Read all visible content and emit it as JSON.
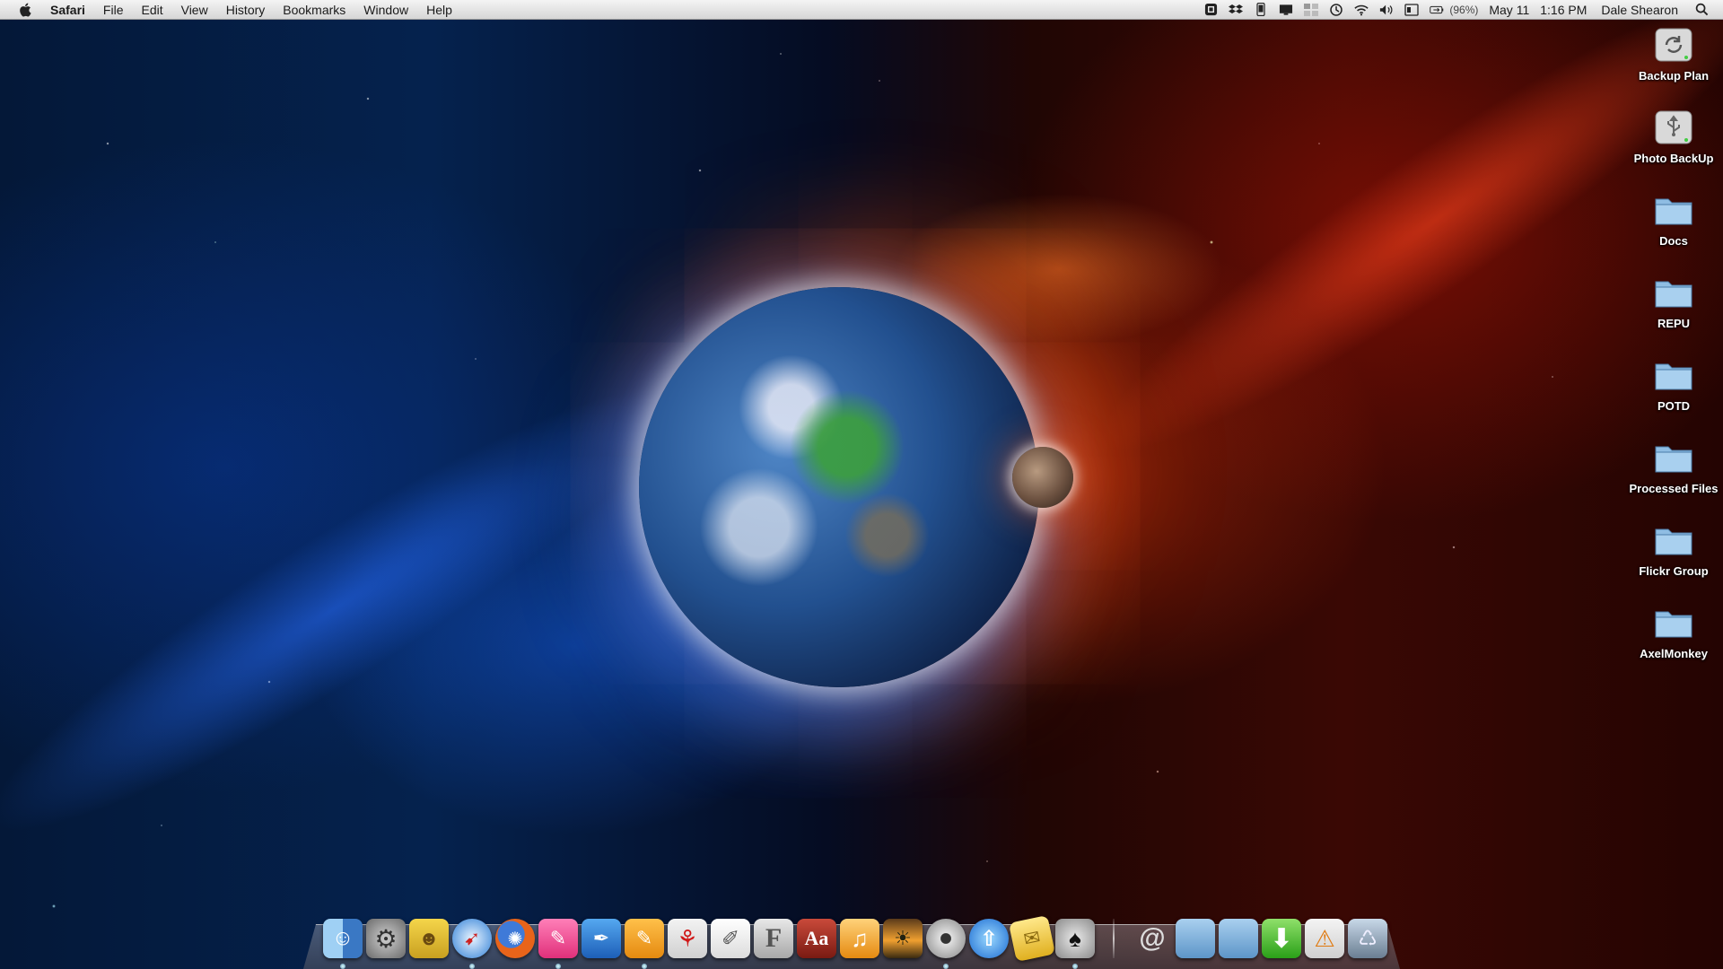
{
  "menubar": {
    "app_name": "Safari",
    "menus": [
      "File",
      "Edit",
      "View",
      "History",
      "Bookmarks",
      "Window",
      "Help"
    ],
    "battery_percent": "(96%)",
    "date": "May 11",
    "time": "1:16 PM",
    "user": "Dale Shearon",
    "status_icons": [
      "script-icon",
      "dropbox-icon",
      "phone-icon",
      "display-icon",
      "spaces-icon",
      "time-machine-icon",
      "wifi-icon",
      "volume-icon",
      "keyboard-icon",
      "battery-icon",
      "spotlight-icon"
    ]
  },
  "desktop": {
    "icons": [
      {
        "label": "Backup Plan",
        "type": "drive-sync"
      },
      {
        "label": "Photo BackUp",
        "type": "usb-drive"
      },
      {
        "label": "Docs",
        "type": "folder"
      },
      {
        "label": "REPU",
        "type": "folder"
      },
      {
        "label": "POTD",
        "type": "folder"
      },
      {
        "label": "Processed Files",
        "type": "folder"
      },
      {
        "label": "Flickr Group",
        "type": "folder"
      },
      {
        "label": "AxelMonkey",
        "type": "folder"
      }
    ]
  },
  "dock": {
    "apps": [
      {
        "name": "finder",
        "running": true
      },
      {
        "name": "system-preferences",
        "running": false
      },
      {
        "name": "simpsons",
        "running": false
      },
      {
        "name": "safari",
        "running": true
      },
      {
        "name": "firefox",
        "running": false
      },
      {
        "name": "pink-pen",
        "running": true
      },
      {
        "name": "blue-pen",
        "running": false
      },
      {
        "name": "orange-pen",
        "running": true
      },
      {
        "name": "adobe-acrobat",
        "running": false
      },
      {
        "name": "textedit",
        "running": false
      },
      {
        "name": "font-book",
        "running": false
      },
      {
        "name": "dictionary",
        "running": false
      },
      {
        "name": "itunes",
        "running": false
      },
      {
        "name": "photo-app",
        "running": false
      },
      {
        "name": "dvd-player",
        "running": true
      },
      {
        "name": "flickr-uploader",
        "running": false
      },
      {
        "name": "stickies",
        "running": false
      },
      {
        "name": "alfred",
        "running": true
      }
    ],
    "stacks": [
      {
        "name": "mail-stack"
      },
      {
        "name": "folder-stack-1"
      },
      {
        "name": "folder-stack-2"
      },
      {
        "name": "downloads"
      },
      {
        "name": "applications"
      },
      {
        "name": "trash"
      }
    ],
    "dictionary_label": "Aa",
    "font_label": "F"
  },
  "colors": {
    "menubar_top": "#f4f4f4",
    "menubar_bottom": "#d6d6d6",
    "folder_blue": "#7fb2dc"
  }
}
